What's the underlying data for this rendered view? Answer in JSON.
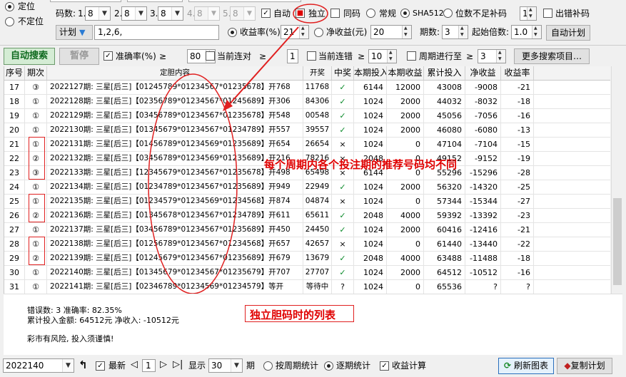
{
  "top": {
    "pos_fixed": "定位",
    "pos_unfixed": "不定位",
    "code_count_label": "码数:",
    "code_combos": [
      {
        "idx": "1.",
        "val": "8",
        "enabled": true
      },
      {
        "idx": "2.",
        "val": "8",
        "enabled": true
      },
      {
        "idx": "3.",
        "val": "8",
        "enabled": true
      },
      {
        "idx": "4.",
        "val": "8",
        "enabled": false
      },
      {
        "idx": "5.",
        "val": "8",
        "enabled": false
      }
    ],
    "auto": "自动",
    "independent": "独立",
    "same_code": "同码",
    "normal": "常规",
    "sha": "SHA512",
    "pad": "位数不足补码",
    "pad_val": "1",
    "error_pad": "出错补码",
    "plan_btn": "计划",
    "plan_input": "1,2,6,",
    "yield_label": "收益率(%)",
    "yield_val": "21",
    "net_label": "净收益(元)",
    "net_val": "20",
    "periods_label": "期数:",
    "periods_val": "3",
    "start_mult_label": "起始倍数:",
    "start_mult_val": "1.0",
    "auto_plan_btn": "自动计划"
  },
  "toolbar": {
    "auto_search": "自动搜索",
    "pause": "暂停",
    "accuracy": "准确率(%)",
    "ge": "≥",
    "accuracy_val": "80",
    "cur_miss": "当前连对",
    "cur_miss_val": "1",
    "cur_err": "当前连错",
    "cur_err_val": "10",
    "cycle": "周期进行至",
    "cycle_val": "3",
    "more": "更多搜索项目…"
  },
  "table": {
    "headers": [
      "序号",
      "期次",
      "定胆内容",
      "开奖",
      "中奖",
      "本期投入",
      "本期收益",
      "累计投入",
      "净收益",
      "收益率"
    ],
    "rows": [
      {
        "seq": "17",
        "round": "③",
        "content": "2022127期: 三星[后三]【01245789*01234567*01235678】开768",
        "draw": "11768",
        "win": "✓",
        "invest": "6144",
        "gain": "12000",
        "total": "43008",
        "net": "-9008",
        "rate": "-21"
      },
      {
        "seq": "18",
        "round": "①",
        "content": "2022128期: 三星[后三]【02356789*01234567*01245689】开306",
        "draw": "84306",
        "win": "✓",
        "invest": "1024",
        "gain": "2000",
        "total": "44032",
        "net": "-8032",
        "rate": "-18"
      },
      {
        "seq": "19",
        "round": "①",
        "content": "2022129期: 三星[后三]【03456789*01234567*01235678】开548",
        "draw": "00548",
        "win": "✓",
        "invest": "1024",
        "gain": "2000",
        "total": "45056",
        "net": "-7056",
        "rate": "-16"
      },
      {
        "seq": "20",
        "round": "①",
        "content": "2022130期: 三星[后三]【01345679*01234567*01234789】开557",
        "draw": "39557",
        "win": "✓",
        "invest": "1024",
        "gain": "2000",
        "total": "46080",
        "net": "-6080",
        "rate": "-13"
      },
      {
        "seq": "21",
        "round": "①",
        "content": "2022131期: 三星[后三]【01456789*01234569*01235689】开654",
        "draw": "26654",
        "win": "×",
        "invest": "1024",
        "gain": "0",
        "total": "47104",
        "net": "-7104",
        "rate": "-15"
      },
      {
        "seq": "22",
        "round": "②",
        "content": "2022132期: 三星[后三]【03456789*01234569*01235689】开216",
        "draw": "78216",
        "win": "×",
        "invest": "2048",
        "gain": "0",
        "total": "49152",
        "net": "-9152",
        "rate": "-19"
      },
      {
        "seq": "23",
        "round": "③",
        "content": "2022133期: 三星[后三]【12345679*01234567*01235678】开498",
        "draw": "65498",
        "win": "×",
        "invest": "6144",
        "gain": "0",
        "total": "55296",
        "net": "-15296",
        "rate": "-28"
      },
      {
        "seq": "24",
        "round": "①",
        "content": "2022134期: 三星[后三]【01234789*01234567*01235689】开949",
        "draw": "22949",
        "win": "✓",
        "invest": "1024",
        "gain": "2000",
        "total": "56320",
        "net": "-14320",
        "rate": "-25"
      },
      {
        "seq": "25",
        "round": "①",
        "content": "2022135期: 三星[后三]【01234579*01234569*01234568】开874",
        "draw": "04874",
        "win": "×",
        "invest": "1024",
        "gain": "0",
        "total": "57344",
        "net": "-15344",
        "rate": "-27"
      },
      {
        "seq": "26",
        "round": "②",
        "content": "2022136期: 三星[后三]【01345678*01234567*01234789】开611",
        "draw": "65611",
        "win": "✓",
        "invest": "2048",
        "gain": "4000",
        "total": "59392",
        "net": "-13392",
        "rate": "-23"
      },
      {
        "seq": "27",
        "round": "①",
        "content": "2022137期: 三星[后三]【03456789*01234567*01235689】开450",
        "draw": "24450",
        "win": "✓",
        "invest": "1024",
        "gain": "2000",
        "total": "60416",
        "net": "-12416",
        "rate": "-21"
      },
      {
        "seq": "28",
        "round": "①",
        "content": "2022138期: 三星[后三]【01256789*01234567*01234568】开657",
        "draw": "42657",
        "win": "×",
        "invest": "1024",
        "gain": "0",
        "total": "61440",
        "net": "-13440",
        "rate": "-22"
      },
      {
        "seq": "29",
        "round": "②",
        "content": "2022139期: 三星[后三]【01245679*01234567*01235689】开679",
        "draw": "13679",
        "win": "✓",
        "invest": "2048",
        "gain": "4000",
        "total": "63488",
        "net": "-11488",
        "rate": "-18"
      },
      {
        "seq": "30",
        "round": "①",
        "content": "2022140期: 三星[后三]【01345679*01234567*01235679】开707",
        "draw": "27707",
        "win": "✓",
        "invest": "1024",
        "gain": "2000",
        "total": "64512",
        "net": "-10512",
        "rate": "-16"
      },
      {
        "seq": "31",
        "round": "①",
        "content": "2022141期: 三星[后三]【02346789*01234569*01234579】等开",
        "draw": "等待中",
        "win": "?",
        "invest": "1024",
        "gain": "0",
        "total": "65536",
        "net": "?",
        "rate": "?"
      }
    ]
  },
  "summary": {
    "line1": "错误数: 3  准确率: 82.35%",
    "line2": "累计投入金额: 64512元   净收入: -10512元",
    "line3": "彩市有风险, 投入须谨慎!"
  },
  "annotations": {
    "note1": "每个周期内各个投注期的推荐号码均不同",
    "note2": "独立胆码时的列表",
    "color": "#e00000"
  },
  "bottom": {
    "period_select": "2022140",
    "latest": "最新",
    "page_val": "1",
    "show": "显示",
    "show_val": "30",
    "period_unit": "期",
    "by_cycle": "按周期统计",
    "by_period": "逐期统计",
    "income_calc": "收益计算",
    "refresh": "刷新图表",
    "copy_plan": "复制计划"
  }
}
